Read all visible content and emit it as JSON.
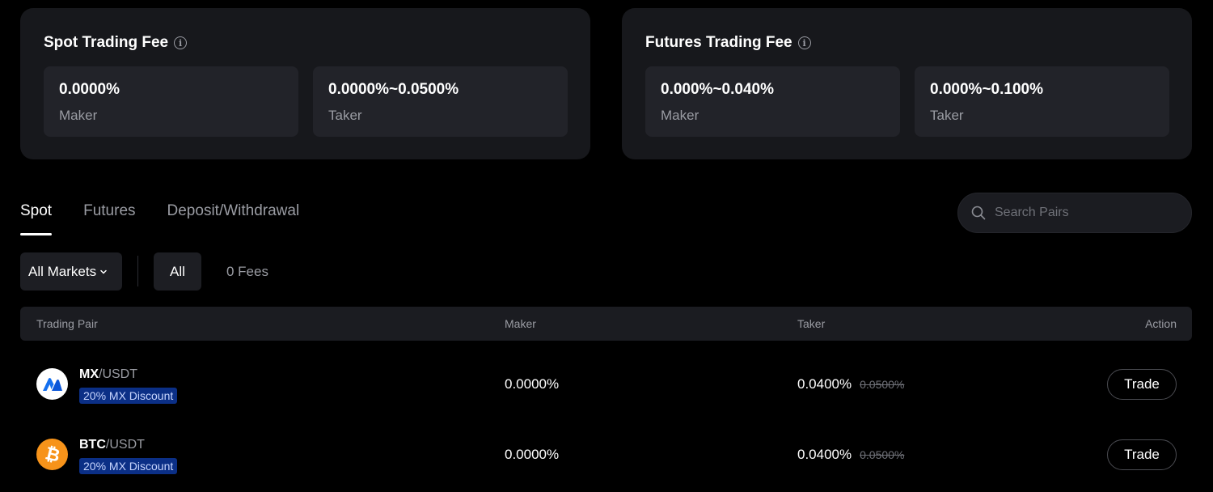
{
  "spot_fee": {
    "title": "Spot Trading Fee",
    "maker": {
      "value": "0.0000%",
      "label": "Maker"
    },
    "taker": {
      "value": "0.0000%~0.0500%",
      "label": "Taker"
    }
  },
  "futures_fee": {
    "title": "Futures Trading Fee",
    "maker": {
      "value": "0.000%~0.040%",
      "label": "Maker"
    },
    "taker": {
      "value": "0.000%~0.100%",
      "label": "Taker"
    }
  },
  "tabs": [
    {
      "label": "Spot",
      "active": true
    },
    {
      "label": "Futures",
      "active": false
    },
    {
      "label": "Deposit/Withdrawal",
      "active": false
    }
  ],
  "search": {
    "placeholder": "Search Pairs",
    "icon": "search-icon"
  },
  "filters": {
    "market_select": "All Markets",
    "chips": [
      "All",
      "0 Fees"
    ],
    "active_chip": "All"
  },
  "table": {
    "headers": {
      "pair": "Trading Pair",
      "maker": "Maker",
      "taker": "Taker",
      "action": "Action"
    },
    "rows": [
      {
        "icon": "mx-logo-icon",
        "base": "MX",
        "quote": "/USDT",
        "badge": "20% MX Discount",
        "maker": "0.0000%",
        "taker": "0.0400%",
        "taker_original": "0.0500%",
        "action": "Trade"
      },
      {
        "icon": "btc-logo-icon",
        "base": "BTC",
        "quote": "/USDT",
        "badge": "20% MX Discount",
        "maker": "0.0000%",
        "taker": "0.0400%",
        "taker_original": "0.0500%",
        "action": "Trade"
      }
    ]
  },
  "colors": {
    "background": "#000000",
    "card": "#17181c",
    "badge_bg": "#0b2f86",
    "btc_orange": "#f7931a"
  }
}
